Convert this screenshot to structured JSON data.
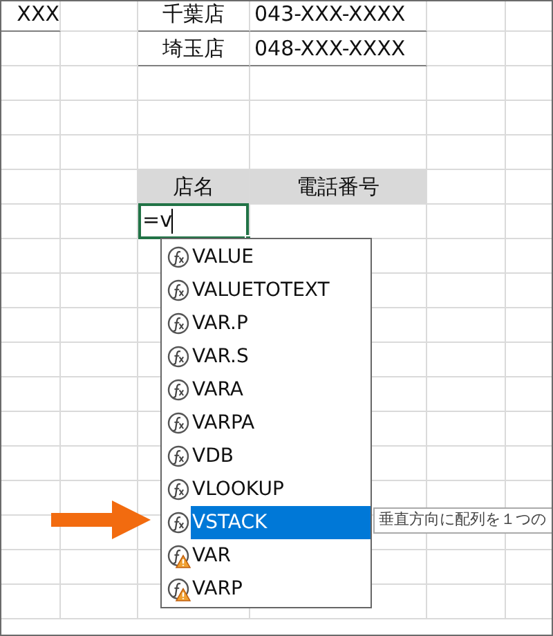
{
  "sheet": {
    "rows": [
      {
        "column_a": "XXX",
        "store": "千葉店",
        "phone": "043-XXX-XXXX"
      },
      {
        "store": "埼玉店",
        "phone": "048-XXX-XXXX"
      }
    ],
    "header": {
      "store": "店名",
      "phone": "電話番号"
    },
    "active_cell": {
      "value": "=v"
    }
  },
  "autocomplete": {
    "items": [
      {
        "label": "VALUE",
        "kind": "function",
        "selected": false
      },
      {
        "label": "VALUETOTEXT",
        "kind": "function",
        "selected": false
      },
      {
        "label": "VAR.P",
        "kind": "function",
        "selected": false
      },
      {
        "label": "VAR.S",
        "kind": "function",
        "selected": false
      },
      {
        "label": "VARA",
        "kind": "function",
        "selected": false
      },
      {
        "label": "VARPA",
        "kind": "function",
        "selected": false
      },
      {
        "label": "VDB",
        "kind": "function",
        "selected": false
      },
      {
        "label": "VLOOKUP",
        "kind": "function",
        "selected": false
      },
      {
        "label": "VSTACK",
        "kind": "function",
        "selected": true
      },
      {
        "label": "VAR",
        "kind": "compatibility",
        "selected": false
      },
      {
        "label": "VARP",
        "kind": "compatibility",
        "selected": false
      }
    ],
    "tooltip": "垂直方向に配列を１つの"
  }
}
